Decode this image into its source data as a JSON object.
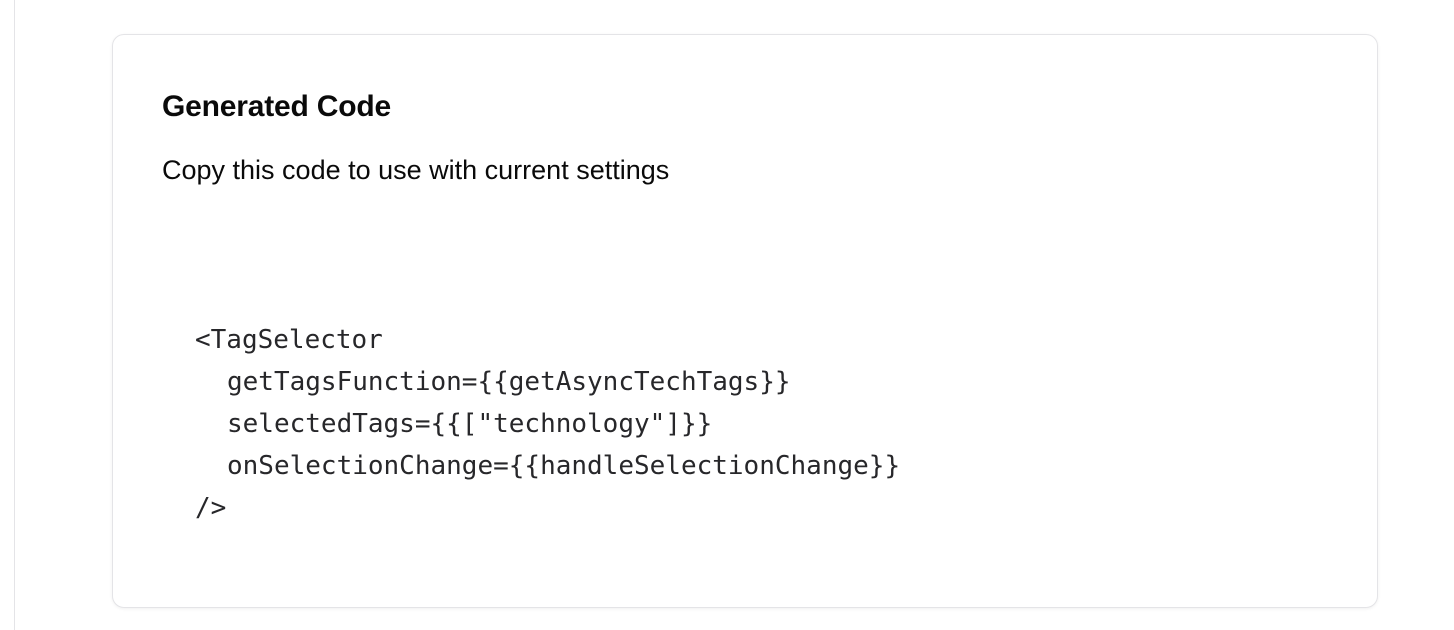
{
  "card": {
    "title": "Generated Code",
    "description": "Copy this code to use with current settings",
    "code_lines": [
      "<TagSelector",
      "getTagsFunction={{getAsyncTechTags}}",
      "selectedTags={{[\"technology\"]}}",
      "onSelectionChange={{handleSelectionChange}}",
      "/>"
    ]
  },
  "colors": {
    "border": "#e4e4e7",
    "text": "#0a0a0a",
    "code_text": "#27272a",
    "background": "#ffffff"
  }
}
